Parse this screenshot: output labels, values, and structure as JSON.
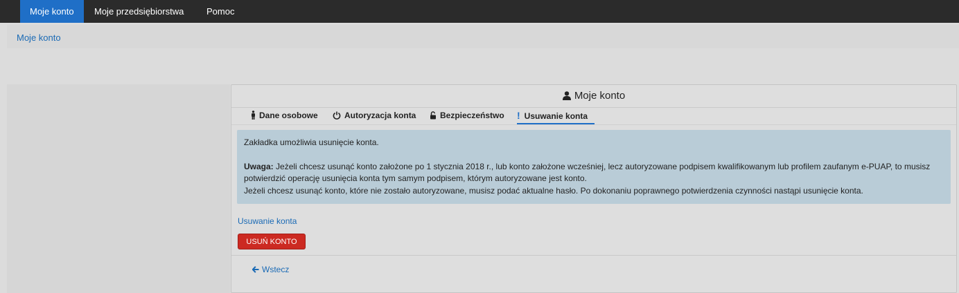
{
  "topnav": {
    "items": [
      {
        "label": "Moje konto",
        "active": true
      },
      {
        "label": "Moje przedsiębiorstwa",
        "active": false
      },
      {
        "label": "Pomoc",
        "active": false
      }
    ]
  },
  "breadcrumb": {
    "label": "Moje konto"
  },
  "panel": {
    "title": "Moje konto",
    "title_icon": "user-icon",
    "tabs": [
      {
        "label": "Dane osobowe",
        "icon": "person-icon",
        "active": false
      },
      {
        "label": "Autoryzacja konta",
        "icon": "power-icon",
        "active": false
      },
      {
        "label": "Bezpieczeństwo",
        "icon": "unlock-icon",
        "active": false
      },
      {
        "label": "Usuwanie konta",
        "icon": "exclamation-icon",
        "active": true
      }
    ],
    "alert": {
      "intro": "Zakładka umożliwia usunięcie konta.",
      "warning_label": "Uwaga:",
      "warning_text": " Jeżeli chcesz usunąć konto założone po 1 stycznia 2018 r., lub konto założone wcześniej, lecz autoryzowane podpisem kwalifikowanym lub profilem zaufanym e-PUAP, to musisz potwierdzić operację usunięcia konta tym samym podpisem, którym autoryzowane jest konto.",
      "note": "Jeżeli chcesz usunąć konto, które nie zostało autoryzowane, musisz podać aktualne hasło. Po dokonaniu poprawnego potwierdzenia czynności nastąpi usunięcie konta."
    },
    "section_link": "Usuwanie konta",
    "delete_button": "USUŃ KONTO",
    "back_link": "Wstecz"
  },
  "colors": {
    "nav_bg": "#2b2b2b",
    "nav_active": "#1f6fc7",
    "link": "#1a6ab5",
    "alert_bg": "#b9ccd7",
    "danger": "#cc2a22"
  }
}
